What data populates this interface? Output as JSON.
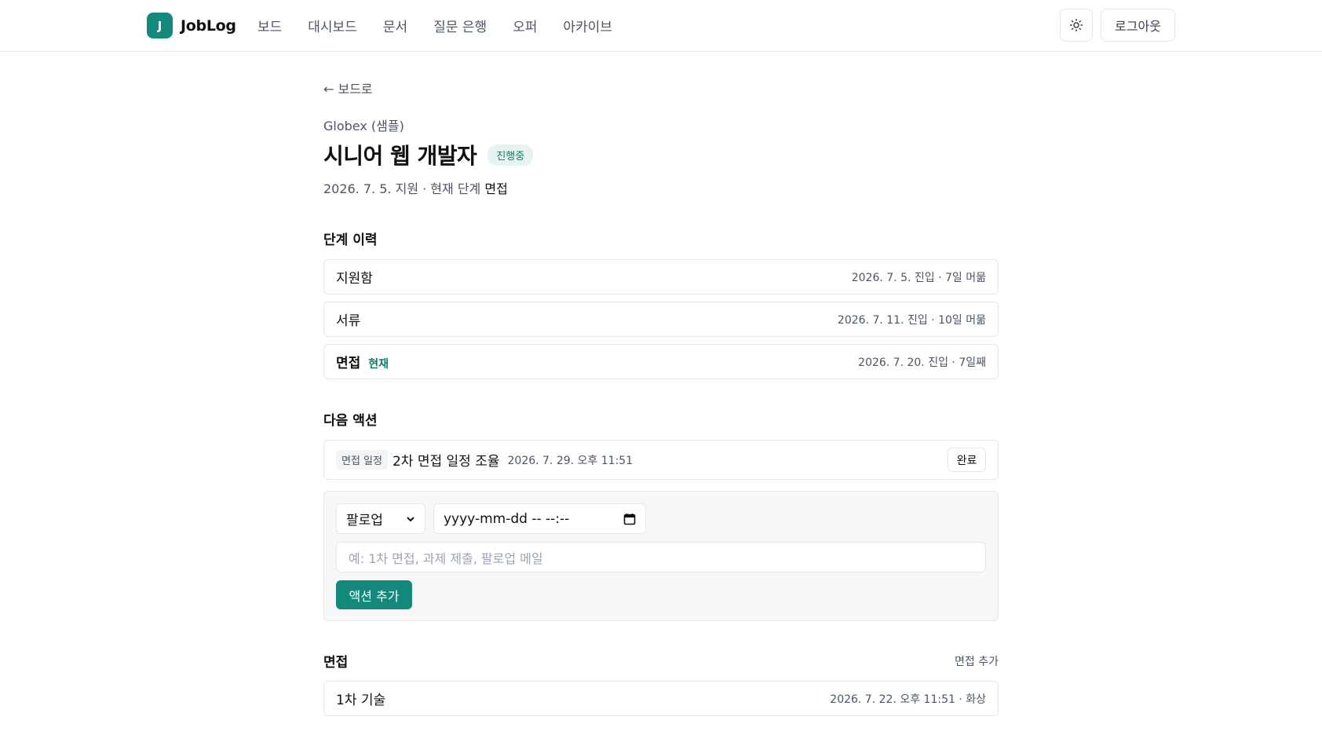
{
  "header": {
    "logo_letter": "J",
    "app_name": "JobLog",
    "nav": [
      "보드",
      "대시보드",
      "문서",
      "질문 은행",
      "오퍼",
      "아카이브"
    ],
    "theme_icon": "sun-icon",
    "logout_label": "로그아웃"
  },
  "page": {
    "back_label": "← 보드로",
    "company": "Globex (샘플)",
    "title": "시니어 웹 개발자",
    "status": "진행중",
    "meta_prefix": "2026. 7. 5. 지원 · 현재 단계 ",
    "meta_stage": "면접"
  },
  "stages": {
    "section_title": "단계 이력",
    "current_label": "현재",
    "items": [
      {
        "name": "지원함",
        "info": "2026. 7. 5. 진입 · 7일 머묾"
      },
      {
        "name": "서류",
        "info": "2026. 7. 11. 진입 · 10일 머묾"
      },
      {
        "name": "면접",
        "info": "2026. 7. 20. 진입 · 7일째"
      }
    ]
  },
  "actions": {
    "section_title": "다음 액션",
    "item": {
      "tag": "면접 일정",
      "title": "2차 면접 일정 조율",
      "date": "2026. 7. 29. 오후 11:51",
      "done_label": "완료"
    },
    "form": {
      "type_value": "팔로업",
      "date_placeholder": "yyyy-mm-dd -- --:--",
      "title_placeholder": "예: 1차 면접, 과제 제출, 팔로업 메일",
      "add_label": "액션 추가"
    }
  },
  "interviews": {
    "section_title": "면접",
    "add_label": "면접 추가",
    "items": [
      {
        "name": "1차 기술",
        "info": "2026. 7. 22. 오후 11:51 · 화상"
      }
    ]
  },
  "colors": {
    "accent": "#12897a",
    "badge_bg": "#e6f4f1",
    "badge_text": "#0f7b6c",
    "border": "#e5e7eb",
    "form_bg": "#f6f7f9"
  }
}
